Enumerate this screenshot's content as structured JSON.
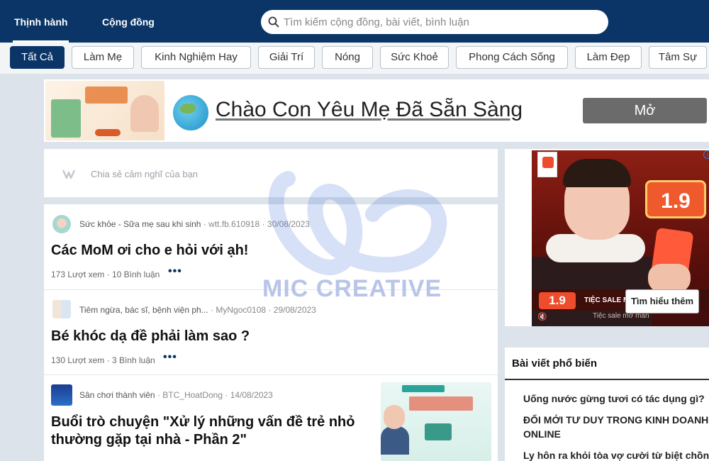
{
  "topnav": {
    "tabs": [
      {
        "label": "Thịnh hành",
        "active": true
      },
      {
        "label": "Cộng đồng",
        "active": false
      }
    ],
    "search_placeholder": "Tìm kiếm cộng đồng, bài viết, bình luận"
  },
  "categories": [
    {
      "label": "Tất Cả",
      "active": true
    },
    {
      "label": "Làm Mẹ"
    },
    {
      "label": "Kinh Nghiệm Hay"
    },
    {
      "label": "Giải Trí"
    },
    {
      "label": "Nóng"
    },
    {
      "label": "Sức Khoẻ"
    },
    {
      "label": "Phong Cách Sống"
    },
    {
      "label": "Làm Đẹp"
    },
    {
      "label": "Tâm Sự"
    }
  ],
  "banner": {
    "title": "Chào Con Yêu Mẹ Đã Sẵn Sàng",
    "open_label": "Mở"
  },
  "composer": {
    "placeholder": "Chia sẻ cảm nghĩ của bạn"
  },
  "posts": [
    {
      "community": "Sức khỏe - Sữa mẹ sau khi sinh",
      "author": "wtt.fb.610918",
      "date": "30/08/2023",
      "title": "Các MoM ơi cho e hỏi với ạh!",
      "views": "173 Lượt xem",
      "comments": "10 Bình luận"
    },
    {
      "community": "Tiêm ngừa, bác sĩ, bệnh viện ph...",
      "author": "MyNgoc0108",
      "date": "29/08/2023",
      "title": "Bé khóc dạ đề phải làm sao ?",
      "views": "130 Lượt xem",
      "comments": "3 Bình luận"
    },
    {
      "community": "Sân chơi thành viên",
      "author": "BTC_HoatDong",
      "date": "14/08/2023",
      "title": "Buổi trò chuyện \"Xử lý những vấn đề trẻ nhỏ thường gặp tại nhà - Phần 2\""
    }
  ],
  "watermark": "MIC CREATIVE",
  "side_ad": {
    "brand": "Shopee",
    "sale_number": "1.9",
    "badge": "1.9",
    "sale_text": "TIỆC SALE MỘ MOMÀN",
    "sale_sub": "Tiệc sale mở màn",
    "cta": "Tìm hiểu thêm"
  },
  "popular": {
    "heading": "Bài viết phổ biến",
    "items": [
      "Uống nước gừng tươi có tác dụng gì?",
      "ĐỔI MỚI TƯ DUY TRONG KINH DOANH ONLINE",
      "Ly hôn ra khỏi tòa vợ cười từ biệt chồng"
    ]
  },
  "colors": {
    "nav_bg": "#0a3566",
    "page_bg": "#dde3ea",
    "accent": "#0a3566"
  }
}
